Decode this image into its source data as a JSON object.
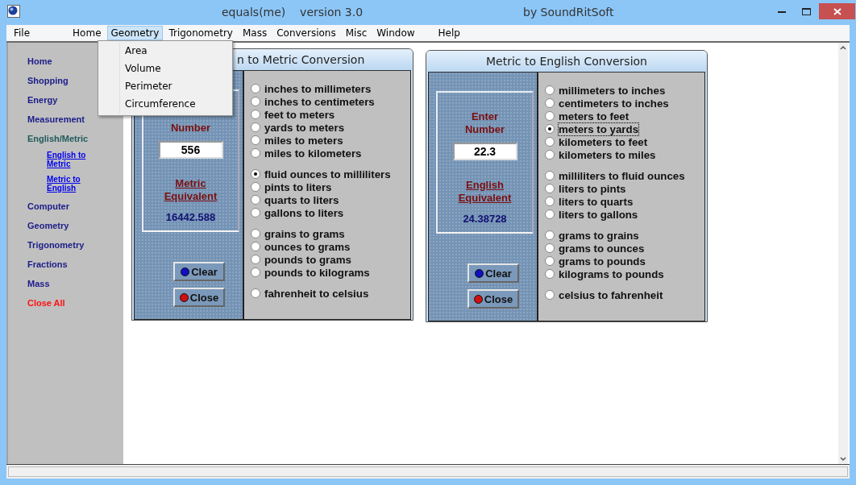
{
  "window": {
    "title": "equals(me)    version 3.0",
    "subtitle": "by SoundRitSoft"
  },
  "menu": [
    {
      "label": "File",
      "selected": false
    },
    {
      "label": "Home",
      "selected": false
    },
    {
      "label": "Geometry",
      "selected": true
    },
    {
      "label": "Trigonometry",
      "selected": false
    },
    {
      "label": "Mass",
      "selected": false
    },
    {
      "label": "Conversions",
      "selected": false
    },
    {
      "label": "Misc",
      "selected": false
    },
    {
      "label": "Window",
      "selected": false
    },
    {
      "label": "Help",
      "selected": false
    }
  ],
  "open_menu": {
    "items": [
      "Area",
      "Volume",
      "Perimeter",
      "Circumference"
    ]
  },
  "sidebar": {
    "items": [
      {
        "label": "Home",
        "kind": "link"
      },
      {
        "label": "Shopping",
        "kind": "link"
      },
      {
        "label": "Energy",
        "kind": "link"
      },
      {
        "label": "Measurement",
        "kind": "link"
      },
      {
        "label": "English/Metric",
        "kind": "current",
        "children": [
          {
            "label": "English to Metric",
            "kind": "sub"
          },
          {
            "label": "Metric to English",
            "kind": "sub"
          }
        ]
      },
      {
        "label": "Computer",
        "kind": "link"
      },
      {
        "label": "Geometry",
        "kind": "link"
      },
      {
        "label": "Trigonometry",
        "kind": "link"
      },
      {
        "label": "Fractions",
        "kind": "link"
      },
      {
        "label": "Mass",
        "kind": "link"
      },
      {
        "label": "Close All",
        "kind": "danger"
      }
    ]
  },
  "windows": [
    {
      "title": "n to Metric Conversion",
      "entry_label": [
        "Number"
      ],
      "value": "556",
      "result_label": "Metric Equivalent",
      "result": "16442.588",
      "buttons": [
        {
          "label": "Clear",
          "color": "#1010c0"
        },
        {
          "label": "Close",
          "color": "#d01010"
        }
      ],
      "groups": [
        {
          "options": [
            {
              "label": "inches to millimeters",
              "selected": false,
              "focused": false
            },
            {
              "label": "inches to centimeters",
              "selected": false,
              "focused": false
            },
            {
              "label": "feet to meters",
              "selected": false,
              "focused": false
            },
            {
              "label": "yards to meters",
              "selected": false,
              "focused": false
            },
            {
              "label": "miles to meters",
              "selected": false,
              "focused": false
            },
            {
              "label": "miles to kilometers",
              "selected": false,
              "focused": false
            }
          ]
        },
        {
          "options": [
            {
              "label": "fluid ounces to milliliters",
              "selected": true,
              "focused": false
            },
            {
              "label": "pints to liters",
              "selected": false,
              "focused": false
            },
            {
              "label": "quarts to liters",
              "selected": false,
              "focused": false
            },
            {
              "label": "gallons to liters",
              "selected": false,
              "focused": false
            }
          ]
        },
        {
          "options": [
            {
              "label": "grains to grams",
              "selected": false,
              "focused": false
            },
            {
              "label": "ounces to grams",
              "selected": false,
              "focused": false
            },
            {
              "label": "pounds to grams",
              "selected": false,
              "focused": false
            },
            {
              "label": "pounds to kilograms",
              "selected": false,
              "focused": false
            }
          ]
        },
        {
          "options": [
            {
              "label": "fahrenheit to celsius",
              "selected": false,
              "focused": false
            }
          ]
        }
      ]
    },
    {
      "title": "Metric to English Conversion",
      "entry_label": [
        "Enter",
        "Number"
      ],
      "value": "22.3",
      "result_label": "English Equivalent",
      "result": "24.38728",
      "buttons": [
        {
          "label": "Clear",
          "color": "#1010c0"
        },
        {
          "label": "Close",
          "color": "#d01010"
        }
      ],
      "groups": [
        {
          "options": [
            {
              "label": "millimeters to inches",
              "selected": false,
              "focused": false
            },
            {
              "label": "centimeters to inches",
              "selected": false,
              "focused": false
            },
            {
              "label": "meters to feet",
              "selected": false,
              "focused": false
            },
            {
              "label": "meters to yards",
              "selected": true,
              "focused": true
            },
            {
              "label": "kilometers to feet",
              "selected": false,
              "focused": false
            },
            {
              "label": "kilometers to miles",
              "selected": false,
              "focused": false
            }
          ]
        },
        {
          "options": [
            {
              "label": "milliliters to fluid ounces",
              "selected": false,
              "focused": false
            },
            {
              "label": "liters to pints",
              "selected": false,
              "focused": false
            },
            {
              "label": "liters to quarts",
              "selected": false,
              "focused": false
            },
            {
              "label": "liters to gallons",
              "selected": false,
              "focused": false
            }
          ]
        },
        {
          "options": [
            {
              "label": "grams to grains",
              "selected": false,
              "focused": false
            },
            {
              "label": "grams to ounces",
              "selected": false,
              "focused": false
            },
            {
              "label": "grams to pounds",
              "selected": false,
              "focused": false
            },
            {
              "label": "kilograms to pounds",
              "selected": false,
              "focused": false
            }
          ]
        },
        {
          "options": [
            {
              "label": "celsius to fahrenheit",
              "selected": false,
              "focused": false
            }
          ]
        }
      ]
    }
  ]
}
